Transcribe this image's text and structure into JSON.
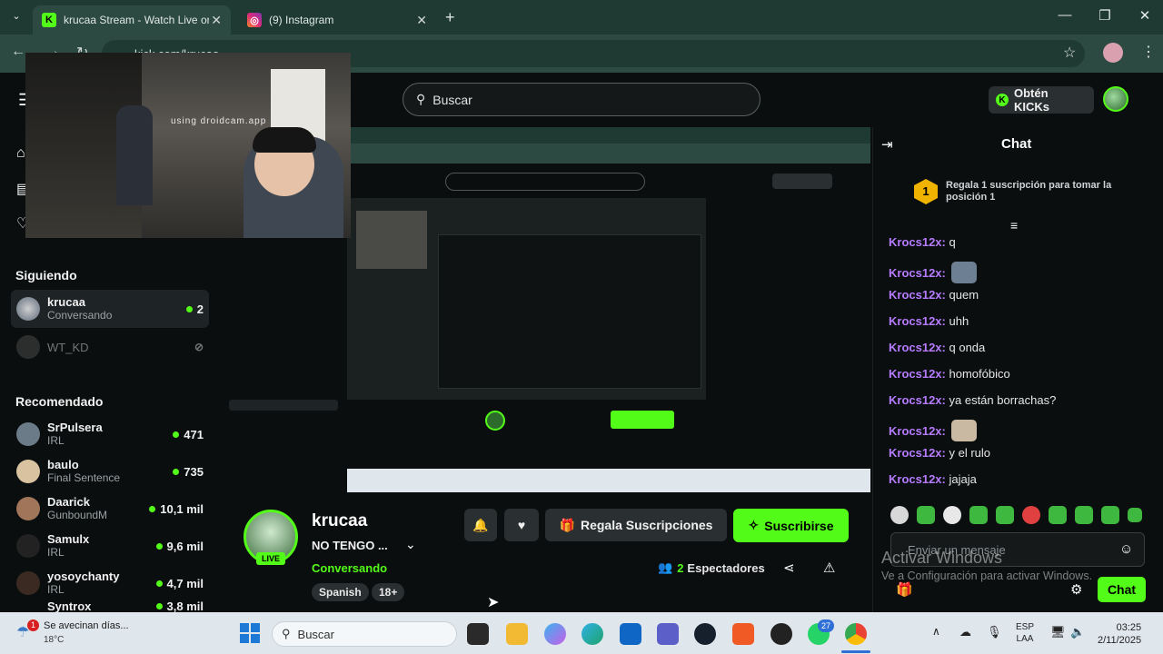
{
  "browser": {
    "tabs": [
      {
        "title": "krucaa Stream - Watch Live on K",
        "active": true
      },
      {
        "title": "(9) Instagram",
        "active": false
      }
    ],
    "url": "kick.com/krucaa"
  },
  "header": {
    "search_placeholder": "Buscar",
    "kicks_label": "Obtén KICKs"
  },
  "sidebar": {
    "following_heading": "Siguiendo",
    "following": [
      {
        "name": "krucaa",
        "sub": "Conversando",
        "viewers": "2"
      },
      {
        "name": "WT_KD",
        "sub": "",
        "viewers": ""
      }
    ],
    "recommended_heading": "Recomendado",
    "recommended": [
      {
        "name": "SrPulsera",
        "sub": "IRL",
        "viewers": "471"
      },
      {
        "name": "baulo",
        "sub": "Final Sentence",
        "viewers": "735"
      },
      {
        "name": "Daarick",
        "sub": "GunboundM",
        "viewers": "10,1 mil"
      },
      {
        "name": "Samulx",
        "sub": "IRL",
        "viewers": "9,6 mil"
      },
      {
        "name": "yosoychanty",
        "sub": "IRL",
        "viewers": "4,7 mil"
      },
      {
        "name": "Syntrox",
        "sub": "",
        "viewers": "3,8 mil"
      }
    ]
  },
  "stream": {
    "overlay_text": "using droidcam.app",
    "channel": "krucaa",
    "title": "NO TENGO ...",
    "category": "Conversando",
    "live_badge": "LIVE",
    "tags": [
      "Spanish",
      "18+"
    ],
    "gift_label": "Regala Suscripciones",
    "subscribe_label": "Suscribirse",
    "viewers_count": "2",
    "viewers_label": "Espectadores"
  },
  "chat": {
    "title": "Chat",
    "pinned": "Regala 1 suscripción para tomar la posición 1",
    "pinned_rank": "1",
    "messages": [
      {
        "user": "Krocs12x:",
        "text": "q"
      },
      {
        "user": "Krocs12x:",
        "text": ""
      },
      {
        "user": "Krocs12x:",
        "text": "quem"
      },
      {
        "user": "Krocs12x:",
        "text": "uhh"
      },
      {
        "user": "Krocs12x:",
        "text": "q onda"
      },
      {
        "user": "Krocs12x:",
        "text": "homofóbico"
      },
      {
        "user": "Krocs12x:",
        "text": "ya están borrachas?"
      },
      {
        "user": "Krocs12x:",
        "text": ""
      },
      {
        "user": "Krocs12x:",
        "text": "y el rulo"
      },
      {
        "user": "Krocs12x:",
        "text": "jajaja"
      }
    ],
    "input_placeholder": "Enviar un mensaje",
    "send_label": "Chat"
  },
  "windows_watermark": {
    "line1": "Activar Windows",
    "line2": "Ve a Configuración para activar Windows."
  },
  "taskbar": {
    "weather_text": "Se avecinan días...",
    "weather_temp": "18°C",
    "weather_badge": "1",
    "search_label": "Buscar",
    "whatsapp_badge": "27",
    "lang": "ESP",
    "lang2": "LAA",
    "time": "03:25",
    "date": "2/11/2025"
  },
  "colors": {
    "kick_green": "#53fc18",
    "chat_username": "#b67cff",
    "background": "#0b0e0f"
  }
}
